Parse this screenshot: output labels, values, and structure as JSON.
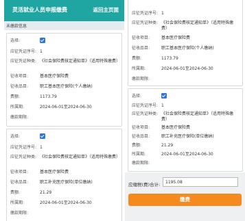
{
  "app": {
    "title": "灵活就业人员申报缴费",
    "back_label": "返回主页面"
  },
  "section_title": "未缴款信息",
  "labels": {
    "select": "选择:",
    "voucher_no": "应征凭证序号:",
    "voucher_type": "应征凭证种类:",
    "item": "征收项目:",
    "subitem": "征收品目:",
    "amount": "费额:",
    "period": "所属期:",
    "deadline": "缴款期限:"
  },
  "left_cards": [
    {
      "checked": true,
      "voucher_no": "1",
      "voucher_type": "《社会保险费核定通知单》（适用特殊缴费）",
      "item": "基本医疗保险费",
      "subitem": "职工基本医疗保险(个人缴纳)",
      "amount": "1173.79",
      "period": "2024-06-01至2024-06-30",
      "deadline": ""
    },
    {
      "checked": true,
      "voucher_no": "1",
      "voucher_type": "《社会保险费核定通知单》（适用特殊缴费）",
      "item": "基本医疗保险费",
      "subitem": "职工补充医疗保险(单位缴纳)",
      "amount": "21.29",
      "period": "2024-06-01至2024-06-30",
      "deadline": ""
    }
  ],
  "right_cards": [
    {
      "voucher_no": "1",
      "voucher_type": "《社会保险费核定通知单》（适用特殊缴费）",
      "item": "基本医疗保险费",
      "subitem": "职工基本医疗保险(个人缴纳)",
      "amount": "1173.79",
      "period": "2024-06-01至2024-06-30",
      "deadline": ""
    },
    {
      "checked": true,
      "voucher_no": "1",
      "voucher_type": "《社会保险费核定通知单》（适用特殊缴费）",
      "item": "基本医疗保险费",
      "subitem": "职工补充医疗保险(单位缴纳)",
      "amount": "21.29",
      "period": "2024-06-01至2024-06-30",
      "deadline": ""
    }
  ],
  "total": {
    "label": "应缴税(费)合计:",
    "value": "1195.08"
  },
  "pay_button": "缴费",
  "colors": {
    "header": "#1fa6a2",
    "checkbox": "#2b76e5",
    "pay_button": "#f58a1f"
  }
}
